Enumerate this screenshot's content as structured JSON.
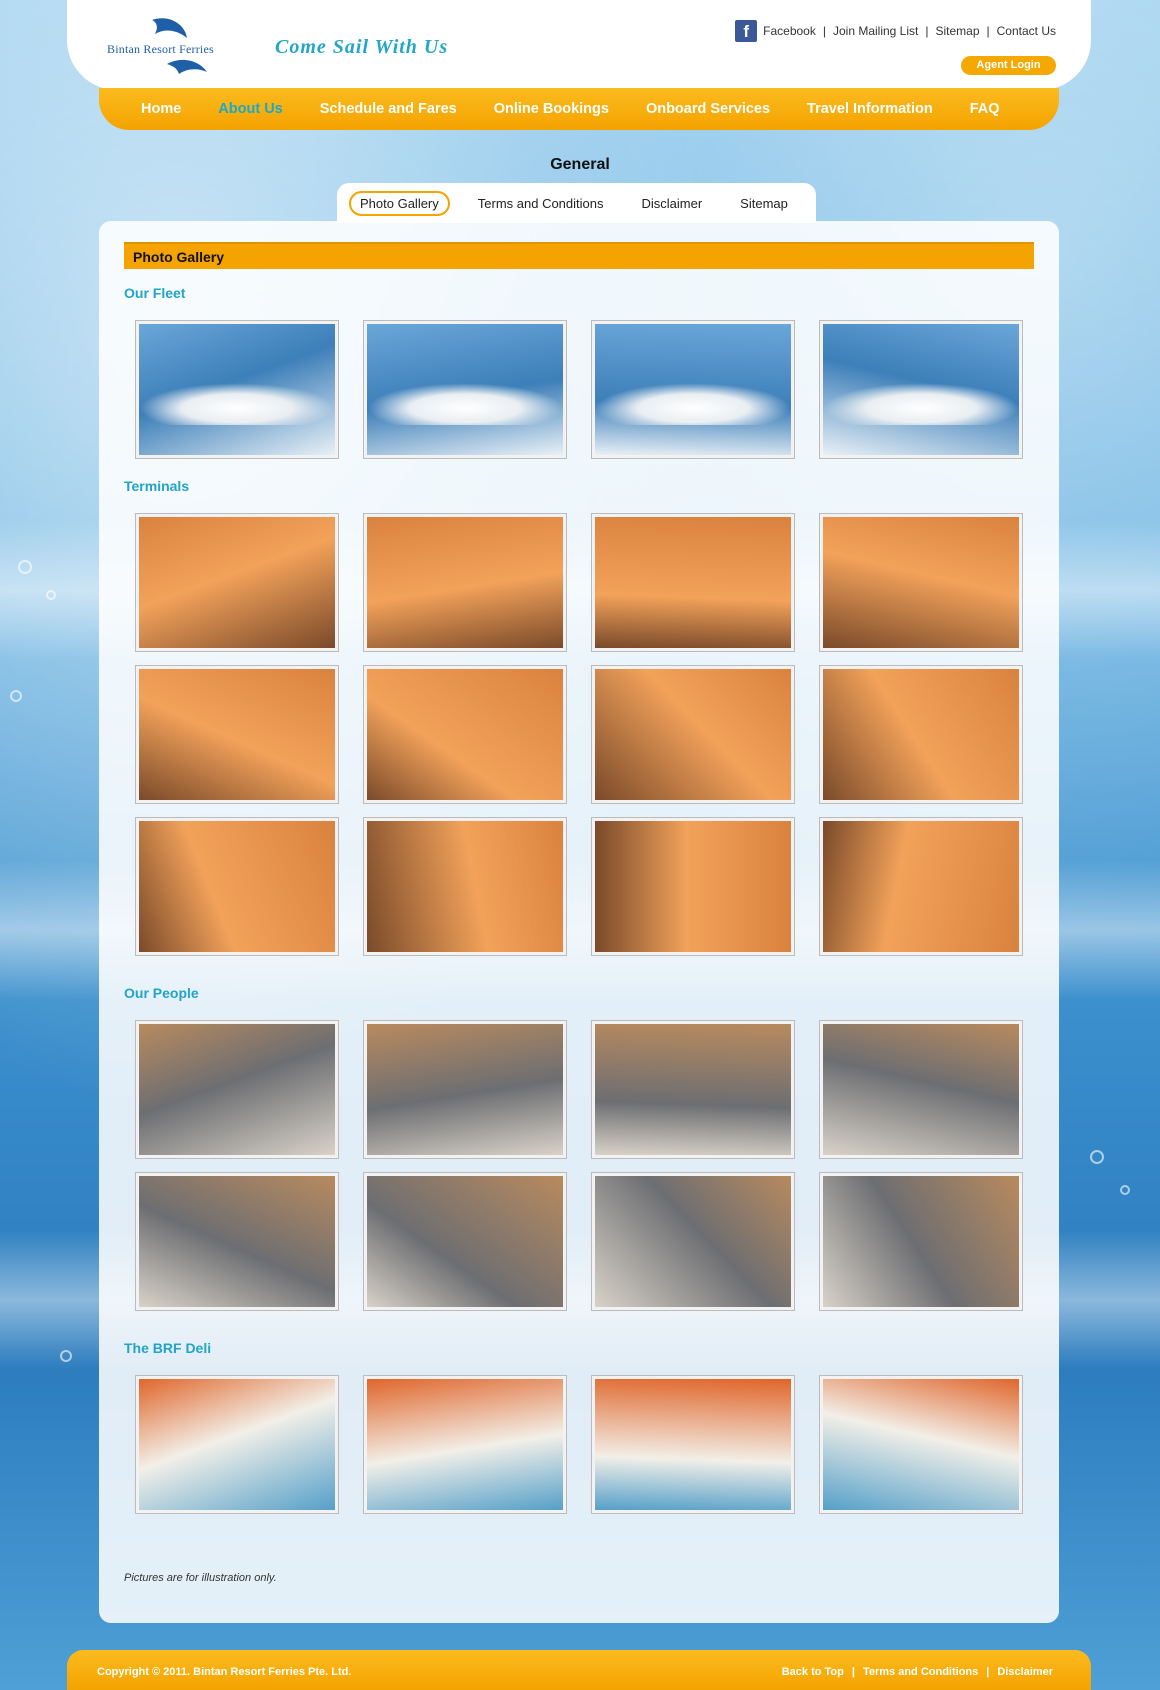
{
  "header": {
    "logo_text": "Bintan Resort Ferries",
    "tagline": "Come Sail With Us",
    "top_links": [
      "Facebook",
      "Join Mailing List",
      "Sitemap",
      "Contact Us"
    ],
    "agent_login": "Agent Login"
  },
  "nav": {
    "items": [
      "Home",
      "About Us",
      "Schedule and Fares",
      "Online Bookings",
      "Onboard Services",
      "Travel Information",
      "FAQ"
    ],
    "active": "About Us"
  },
  "section": {
    "title": "General",
    "tabs": [
      "Photo Gallery",
      "Terms and Conditions",
      "Disclaimer",
      "Sitemap"
    ],
    "active_tab": "Photo Gallery"
  },
  "gallery": {
    "heading": "Photo Gallery",
    "categories": [
      {
        "name": "Our Fleet",
        "rows": 1
      },
      {
        "name": "Terminals",
        "rows": 3
      },
      {
        "name": "Our People",
        "rows": 2
      },
      {
        "name": "The BRF Deli",
        "rows": 1
      }
    ],
    "note": "Pictures are for illustration only."
  },
  "footer": {
    "copyright": "Copyright © 2011. Bintan Resort Ferries Pte. Ltd.",
    "links": [
      "Back to Top",
      "Terms and Conditions",
      "Disclaimer"
    ]
  },
  "colors": {
    "accent_orange": "#f4a300",
    "accent_teal": "#21a4c8"
  }
}
